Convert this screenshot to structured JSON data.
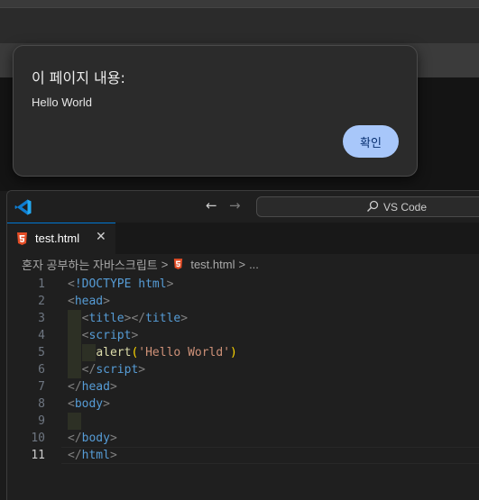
{
  "alert": {
    "title": "이 페이지 내용:",
    "message": "Hello World",
    "ok_label": "확인"
  },
  "vscode": {
    "nav": {
      "back_icon": "←",
      "forward_icon": "→"
    },
    "search_label": "VS Code",
    "tab": {
      "label": "test.html",
      "close_icon": "✕"
    },
    "breadcrumb": {
      "folder": "혼자 공부하는 자바스크립트",
      "separator": ">",
      "file": "test.html",
      "more": "..."
    },
    "colors": {
      "accent": "#0078d4",
      "html_icon": "#e44d26",
      "alert_button": "#a8c7fa"
    },
    "code_lines": [
      {
        "num": "1",
        "tokens": [
          [
            "tag",
            "<"
          ],
          [
            "doc",
            "!DOCTYPE"
          ],
          [
            "txt",
            " "
          ],
          [
            "tn",
            "html"
          ],
          [
            "tag",
            ">"
          ]
        ]
      },
      {
        "num": "2",
        "tokens": [
          [
            "tag",
            "<"
          ],
          [
            "tn",
            "head"
          ],
          [
            "tag",
            ">"
          ]
        ]
      },
      {
        "num": "3",
        "tokens": [
          [
            "txt",
            "  "
          ],
          [
            "tag",
            "<"
          ],
          [
            "tn",
            "title"
          ],
          [
            "tag",
            "></"
          ],
          [
            "tn",
            "title"
          ],
          [
            "tag",
            ">"
          ]
        ]
      },
      {
        "num": "4",
        "tokens": [
          [
            "txt",
            "  "
          ],
          [
            "tag",
            "<"
          ],
          [
            "tn",
            "script"
          ],
          [
            "tag",
            ">"
          ]
        ]
      },
      {
        "num": "5",
        "tokens": [
          [
            "txt",
            "    "
          ],
          [
            "fn",
            "alert"
          ],
          [
            "paren",
            "("
          ],
          [
            "str",
            "'Hello World'"
          ],
          [
            "paren",
            ")"
          ]
        ]
      },
      {
        "num": "6",
        "tokens": [
          [
            "txt",
            "  "
          ],
          [
            "tag",
            "</"
          ],
          [
            "tn",
            "script"
          ],
          [
            "tag",
            ">"
          ]
        ]
      },
      {
        "num": "7",
        "tokens": [
          [
            "tag",
            "</"
          ],
          [
            "tn",
            "head"
          ],
          [
            "tag",
            ">"
          ]
        ]
      },
      {
        "num": "8",
        "tokens": [
          [
            "tag",
            "<"
          ],
          [
            "tn",
            "body"
          ],
          [
            "tag",
            ">"
          ]
        ]
      },
      {
        "num": "9",
        "tokens": []
      },
      {
        "num": "10",
        "tokens": [
          [
            "tag",
            "</"
          ],
          [
            "tn",
            "body"
          ],
          [
            "tag",
            ">"
          ]
        ]
      },
      {
        "num": "11",
        "tokens": [
          [
            "tag",
            "</"
          ],
          [
            "tn",
            "html"
          ],
          [
            "tag",
            ">"
          ]
        ]
      }
    ],
    "active_line": "11"
  }
}
